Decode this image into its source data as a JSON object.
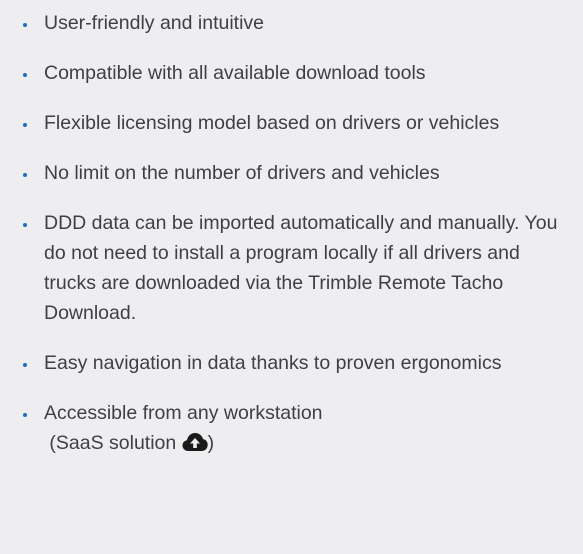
{
  "features": [
    {
      "text": "User-friendly and intuitive"
    },
    {
      "text": "Compatible with all available download tools"
    },
    {
      "text": "Flexible licensing model based on drivers or vehicles"
    },
    {
      "text": "No limit on the number of drivers and vehicles"
    },
    {
      "text": "DDD data can be imported automatically and manually. You do not need to install a program locally if all drivers and trucks are downloaded via the Trimble Remote Tacho Download."
    },
    {
      "text": "Easy navigation in data thanks to proven ergonomics"
    },
    {
      "line1": "Accessible from any workstation",
      "line2_prefix": "(SaaS solution",
      "line2_suffix": ")",
      "icon": "cloud-upload-icon"
    }
  ],
  "colors": {
    "background": "#eeeef0",
    "text": "#3f3f44",
    "bullet": "#1b6ec2",
    "icon": "#1a1a1a"
  }
}
